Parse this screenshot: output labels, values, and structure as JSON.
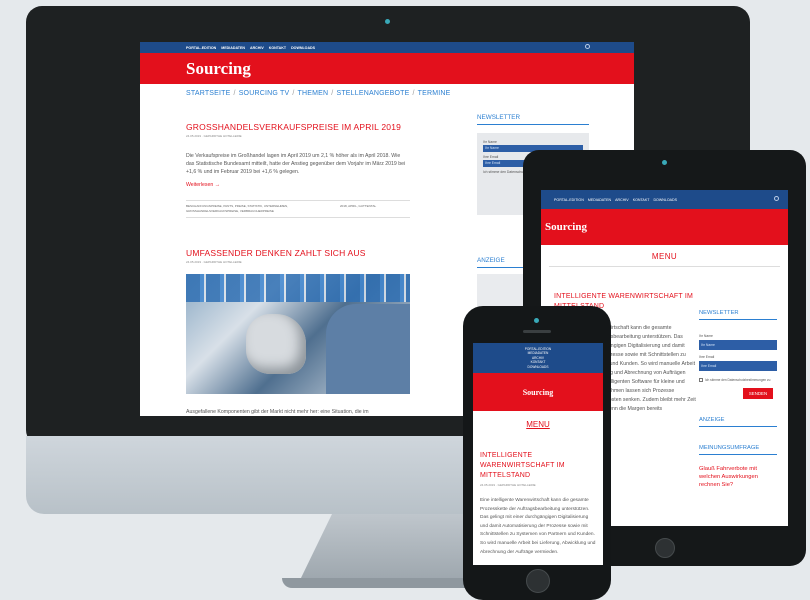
{
  "desktop": {
    "topbar_items": [
      "PORTAL-EDITION",
      "MEDIADATEN",
      "ARCHIV",
      "KONTAKT",
      "DOWNLOADS"
    ],
    "logo": "Sourcing",
    "nav": [
      "STARTSEITE",
      "SOURCING TV",
      "THEMEN",
      "STELLENANGEBOTE",
      "TERMINE"
    ],
    "post1": {
      "title": "GROSSHANDELSVERKAUFSPREISE IM APRIL 2019",
      "meta": "24.05.2019 · GEPARDTHE HOTELLERIE",
      "excerpt": "Die Verkaufspreise im Großhandel lagen im April 2019 um 2,1 % höher als im April 2018. Wie das Statistische Bundesamt mitteilt, hatte der Anstieg gegenüber dem Vorjahr im März 2019 bei +1,6 % und im Februar 2019 bei +1,6 % gelegen.",
      "read_more": "Weiterlesen →",
      "tags_left": "BESCHAFFUNGSPREISE, PANTS, PREISE, STATISTIK, UNTERNEHMEN, GROSSHANDELSVERKAUFSPREISE, VERBRAUCHERPREISE",
      "tags_right": "2018, APRIL, GUTTENTAL"
    },
    "post2": {
      "title": "UMFASSENDER DENKEN ZAHLT SICH AUS",
      "meta": "24.05.2019 · GEPARDTHE HOTELLERIE",
      "excerpt": "Ausgefallene Komponenten gibt der Markt nicht mehr her: eine Situation, die im"
    },
    "sidebar": {
      "newsletter_heading": "NEWSLETTER",
      "name_label": "Ihr Name",
      "name_placeholder": "Ihr Name",
      "email_label": "Ihre Email",
      "email_placeholder": "Ihre Email",
      "consent": "Ich stimme den Datenschutzbestimmungen zu",
      "ad_heading": "ANZEIGE"
    }
  },
  "tablet": {
    "topbar_items": [
      "PORTAL-EDITION",
      "MEDIADATEN",
      "ARCHIV",
      "KONTAKT",
      "DOWNLOADS"
    ],
    "logo": "Sourcing",
    "menu": "MENU",
    "post": {
      "title": "INTELLIGENTE WARENWIRTSCHAFT IM MITTELSTAND",
      "text": "Eine intelligente Warenwirtschaft kann die gesamte Prozesskette der Auftragsbearbeitung unterstützen. Das gelingt mit einer durchgängigen Digitalisierung und damit Automatisierung der Prozesse sowie mit Schnittstellen zu Systemen von Partnern und Kunden. So wird manuelle Arbeit bei Lieferung, Abwicklung und Abrechnung von Aufträgen vermieden. Mit einer intelligenten Software für kleine und mittelständische Unternehmen lassen sich Prozesse verbessern und damit Kosten senken. Zudem bleibt mehr Zeit für die Kernaufgaben, wenn die Margen bereits"
    },
    "sidebar": {
      "newsletter_heading": "NEWSLETTER",
      "name_label": "Ihr Name",
      "name_placeholder": "Ihr Name",
      "email_label": "Ihre Email",
      "email_placeholder": "Ihre Email",
      "consent": "Ich stimme den Datenschutzbestimmungen zu",
      "send": "SENDEN",
      "ad_heading": "ANZEIGE",
      "survey_heading": "MEINUNGSUMFRAGE",
      "survey_question": "Glauß Fahrverbote mit welchen Auswirkungen rechnen Sie?"
    }
  },
  "phone": {
    "topbar_lines": [
      "PORTAL-EDITION",
      "MEDIADATEN",
      "ARCHIV",
      "KONTAKT",
      "DOWNLOADS"
    ],
    "logo": "Sourcing",
    "menu": "MENU",
    "post": {
      "title": "INTELLIGENTE WARENWIRTSCHAFT IM MITTELSTAND",
      "meta": "24.05.2019 · GEPARDTHE HOTELLERIE",
      "text": "Eine intelligente Warenwirtschaft kann die gesamte Prozesskette der Auftragsbearbeitung unterstützen. Das gelingt mit einer durchgängigen Digitalisierung und damit Automatisierung der Prozesse sowie mit Schnittstellen zu Systemen von Partnern und Kunden. So wird manuelle Arbeit bei Lieferung, Abwicklung und Abrechnung der Aufträge vermieden."
    }
  },
  "colors": {
    "brand_red": "#e3101c",
    "brand_blue": "#1e4b8a",
    "link_blue": "#2b7fd1"
  }
}
